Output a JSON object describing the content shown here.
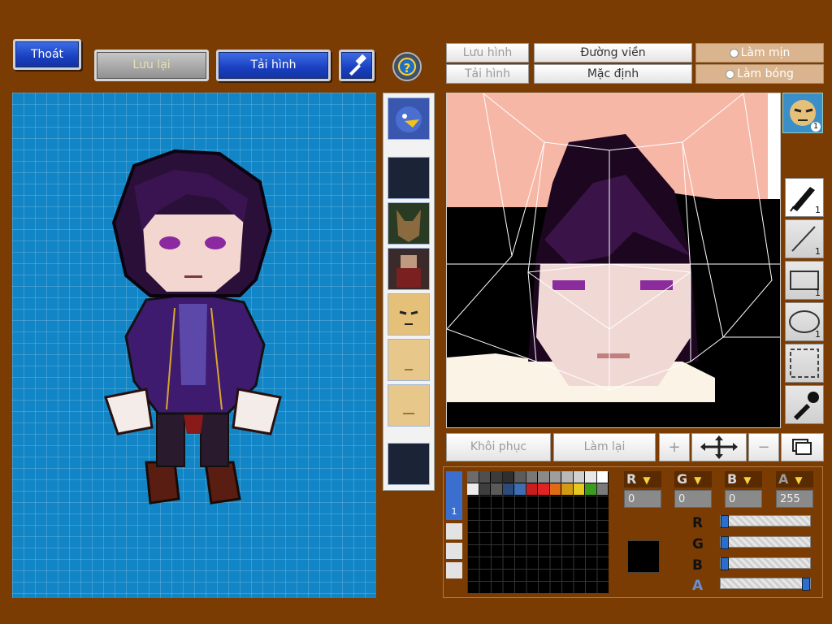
{
  "toolbar": {
    "exit_label": "Thoát",
    "save_label": "Lưu lại",
    "load_image_label": "Tải hình",
    "help_symbol": "?"
  },
  "editor_top": {
    "save_image_label": "Lưu hình",
    "load_image_label": "Tải hình",
    "outline_label": "Đường viền",
    "default_label": "Mặc định",
    "smooth_label": "Làm mịn",
    "shade_label": "Làm bóng"
  },
  "tools": {
    "pen_count": "1",
    "line_count": "1",
    "rect_count": "1",
    "ellipse_count": "1",
    "face_badge": "1"
  },
  "actions": {
    "restore_label": "Khôi phục",
    "redo_label": "Làm lại",
    "zoom_in_symbol": "+",
    "zoom_out_symbol": "−"
  },
  "color": {
    "channels": [
      {
        "label": "R",
        "value": "0"
      },
      {
        "label": "G",
        "value": "0"
      },
      {
        "label": "B",
        "value": "0"
      },
      {
        "label": "A",
        "value": "255"
      }
    ],
    "sliders": [
      {
        "label": "R",
        "level": 0
      },
      {
        "label": "G",
        "level": 0
      },
      {
        "label": "B",
        "level": 0
      },
      {
        "label": "A",
        "level": 1
      }
    ],
    "current_color": "#000000",
    "palette_page": "1",
    "palette": [
      "#6b6b6b",
      "#4f4f4f",
      "#3b3b3b",
      "#2f2f2f",
      "#5b5b5b",
      "#787878",
      "#8a8a8a",
      "#9e9e9e",
      "#b8b8b8",
      "#d0d0d0",
      "#e8e8e8",
      "#ffffff",
      "#ececec",
      "#3e3e3e",
      "#5a5a5a",
      "#2c4a7a",
      "#3d6fb0",
      "#c81e1e",
      "#e02424",
      "#e06b14",
      "#d29b12",
      "#e6c81e",
      "#3c9c1e",
      "#7a7a7a"
    ]
  }
}
